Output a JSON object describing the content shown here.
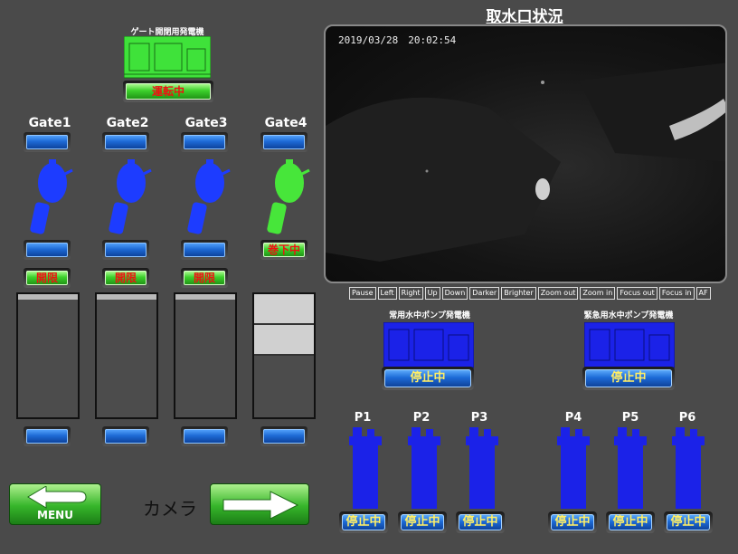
{
  "header": {
    "title": "取水口状況"
  },
  "gate_generator": {
    "label": "ゲート開閉用発電機",
    "status": "運転中"
  },
  "gates": [
    {
      "name": "Gate1",
      "limit": "開限",
      "color": "#1d3cff"
    },
    {
      "name": "Gate2",
      "limit": "開限",
      "color": "#1d3cff"
    },
    {
      "name": "Gate3",
      "limit": "開限",
      "color": "#1d3cff"
    },
    {
      "name": "Gate4",
      "status": "巻下中",
      "color": "#47e63a"
    }
  ],
  "camera": {
    "timestamp": "2019/03/28　20:02:54",
    "controls": [
      "Pause",
      "Left",
      "Right",
      "Up",
      "Down",
      "Darker",
      "Brighter",
      "Zoom out",
      "Zoom in",
      "Focus out",
      "Focus in",
      "AF"
    ]
  },
  "pump_generators": [
    {
      "label": "常用水中ポンプ発電機",
      "status": "停止中"
    },
    {
      "label": "緊急用水中ポンプ発電機",
      "status": "停止中"
    }
  ],
  "pumps": [
    {
      "name": "P1",
      "status": "停止中"
    },
    {
      "name": "P2",
      "status": "停止中"
    },
    {
      "name": "P3",
      "status": "停止中"
    },
    {
      "name": "P4",
      "status": "停止中"
    },
    {
      "name": "P5",
      "status": "停止中"
    },
    {
      "name": "P6",
      "status": "停止中"
    }
  ],
  "nav": {
    "menu_label": "MENU",
    "camera_label": "カメラ"
  },
  "colors": {
    "background": "#4a4a4a",
    "gate_blue": "#1d3cff",
    "gate_green": "#47e63a",
    "pump_blue": "#1b22e8"
  }
}
